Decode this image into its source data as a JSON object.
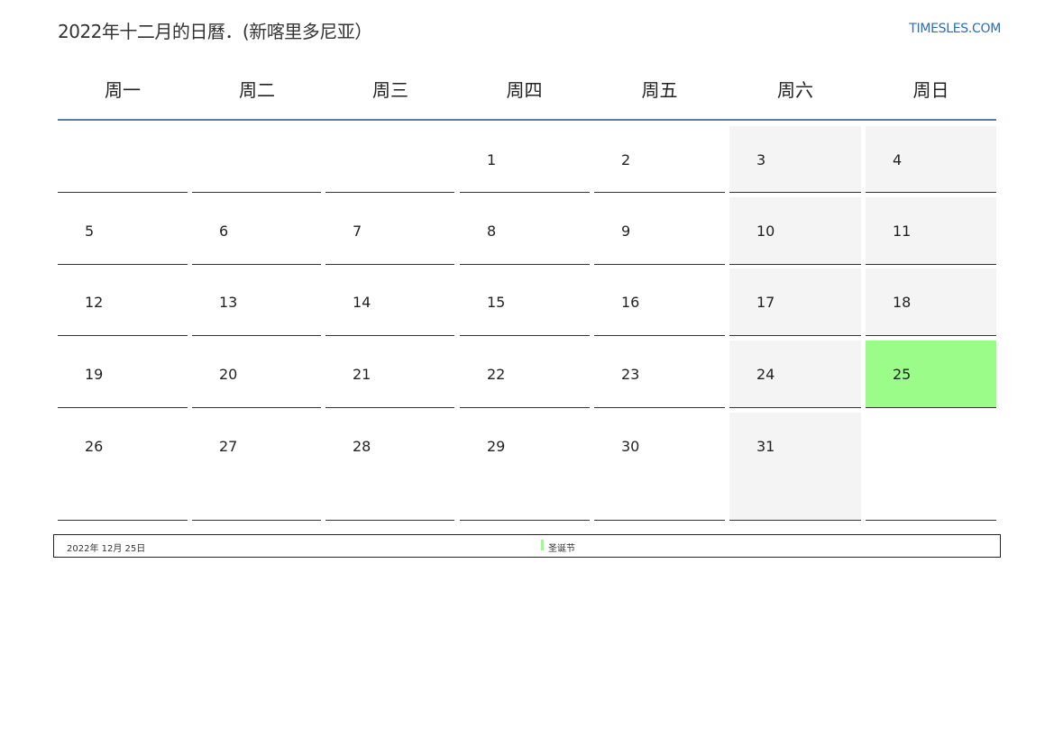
{
  "header": {
    "title": "2022年十二月的日曆．(新喀里多尼亚）",
    "brand": "TIMESLES.COM"
  },
  "weekdays": [
    "周一",
    "周二",
    "周三",
    "周四",
    "周五",
    "周六",
    "周日"
  ],
  "weeks": [
    [
      "",
      "",
      "",
      "1",
      "2",
      "3",
      "4"
    ],
    [
      "5",
      "6",
      "7",
      "8",
      "9",
      "10",
      "11"
    ],
    [
      "12",
      "13",
      "14",
      "15",
      "16",
      "17",
      "18"
    ],
    [
      "19",
      "20",
      "21",
      "22",
      "23",
      "24",
      "25"
    ],
    [
      "26",
      "27",
      "28",
      "29",
      "30",
      "31",
      ""
    ]
  ],
  "holidays": [
    {
      "date_label": "2022年 12月 25日",
      "name": "圣诞节",
      "day": "25",
      "color": "#9cfc8a"
    }
  ],
  "colors": {
    "weekend_bg": "#f4f4f4",
    "holiday_bg": "#9cfc8a",
    "header_rule": "#5b7ca6",
    "brand": "#2a6db5"
  }
}
